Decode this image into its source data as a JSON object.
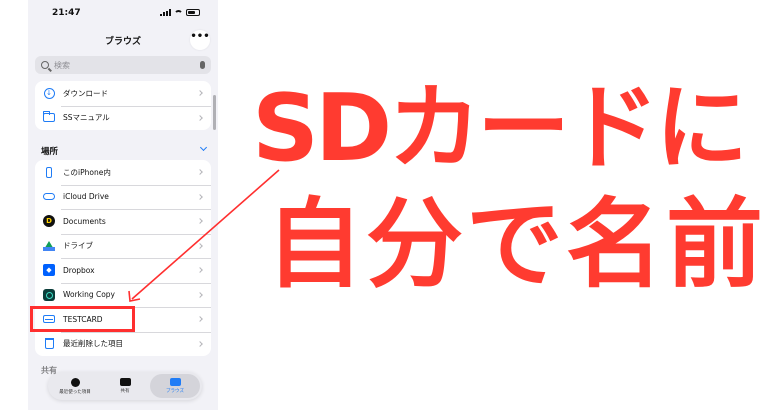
{
  "status_bar": {
    "time": "21:47"
  },
  "nav": {
    "title": "ブラウズ",
    "more_label": "•••"
  },
  "search": {
    "placeholder": "検索"
  },
  "favorites": [
    {
      "label": "ダウンロード",
      "icon": "download-icon"
    },
    {
      "label": "SSマニュアル",
      "icon": "folder-icon"
    }
  ],
  "locations": {
    "header": "場所",
    "items": [
      {
        "label": "このiPhone内",
        "icon": "iphone-icon"
      },
      {
        "label": "iCloud Drive",
        "icon": "icloud-icon"
      },
      {
        "label": "Documents",
        "icon": "documents-app-icon"
      },
      {
        "label": "ドライブ",
        "icon": "google-drive-icon"
      },
      {
        "label": "Dropbox",
        "icon": "dropbox-icon"
      },
      {
        "label": "Working Copy",
        "icon": "working-copy-icon"
      },
      {
        "label": "TESTCARD",
        "icon": "external-drive-icon"
      },
      {
        "label": "最近削除した項目",
        "icon": "trash-icon"
      }
    ]
  },
  "tabs": [
    {
      "label": "最近使った項目",
      "icon": "clock-icon",
      "active": false
    },
    {
      "label": "共有",
      "icon": "shared-icon",
      "active": false
    },
    {
      "label": "ブラウズ",
      "icon": "folder-icon",
      "active": true
    }
  ],
  "peek_header": "共有",
  "caption": {
    "line1": "SDカードに",
    "line2": "自分で名前",
    "color": "#ff3b30"
  },
  "accent_color": "#1f7cf6",
  "highlight_color": "#ff2f2f"
}
